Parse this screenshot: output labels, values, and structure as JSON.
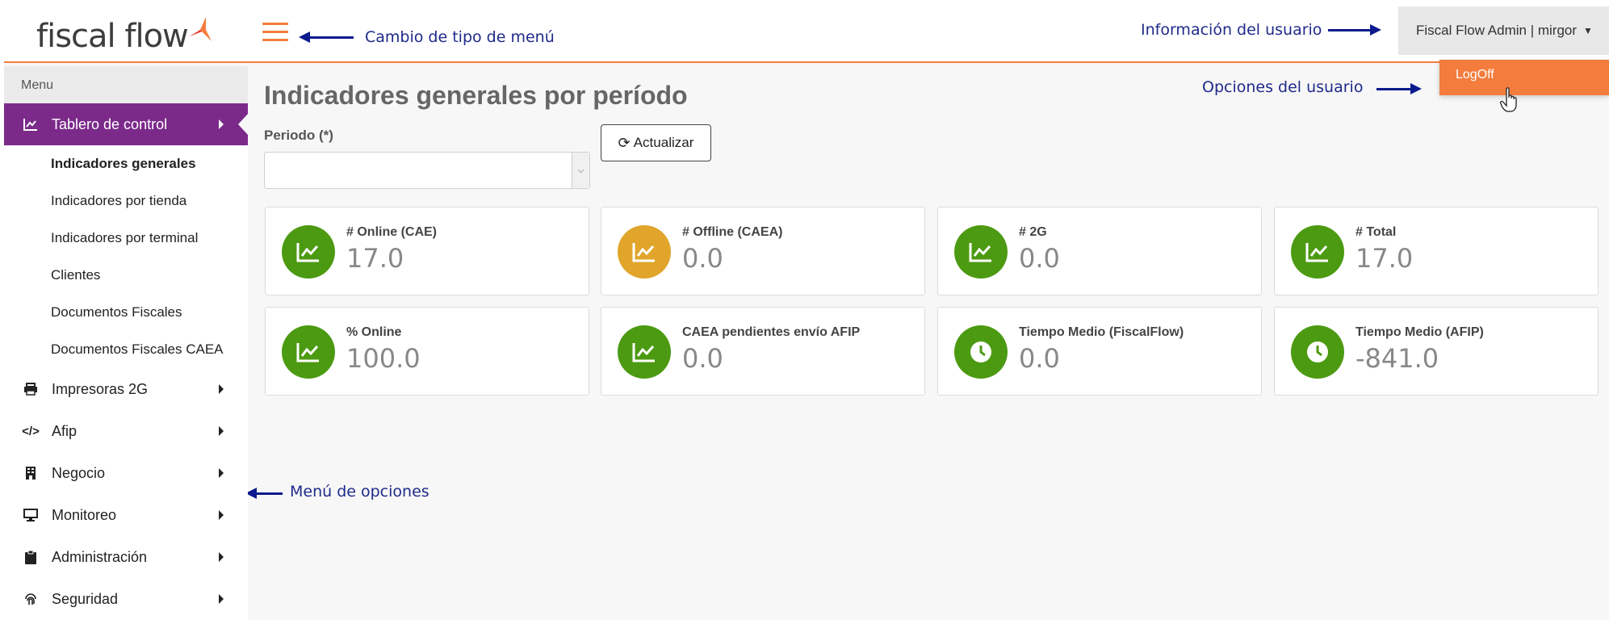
{
  "colors": {
    "accent": "#f47c3c",
    "active_nav": "#7b2a8a",
    "green": "#4c9a12",
    "yellow": "#e0a52a",
    "annotation": "#1f2a8a"
  },
  "brand": {
    "logo_text": "fiscal flow"
  },
  "header": {
    "user_label": "Fiscal Flow Admin | mirgor",
    "caret_icon": "caret-down-icon"
  },
  "user_menu": {
    "logoff_label": "LogOff"
  },
  "annotations": {
    "menu_type": "Cambio de tipo de menú",
    "user_info": "Información del usuario",
    "user_options": "Opciones del usuario",
    "menu_options": "Menú de opciones"
  },
  "sidebar": {
    "heading": "Menu",
    "active_item": {
      "label": "Tablero de control",
      "icon": "chart-line-icon"
    },
    "subitems": [
      "Indicadores generales",
      "Indicadores por tienda",
      "Indicadores por terminal",
      "Clientes",
      "Documentos Fiscales",
      "Documentos Fiscales CAEA"
    ],
    "items": [
      {
        "label": "Impresoras 2G",
        "icon": "printer-icon"
      },
      {
        "label": "Afip",
        "icon": "code-icon"
      },
      {
        "label": "Negocio",
        "icon": "building-icon"
      },
      {
        "label": "Monitoreo",
        "icon": "monitor-icon"
      },
      {
        "label": "Administración",
        "icon": "clipboard-icon"
      },
      {
        "label": "Seguridad",
        "icon": "fingerprint-icon"
      }
    ]
  },
  "main": {
    "title": "Indicadores generales por período",
    "period_label": "Periodo (*)",
    "period_value": "",
    "refresh_label": "Actualizar",
    "cards": [
      {
        "label": "# Online (CAE)",
        "value": "17.0",
        "icon": "chart-line-icon",
        "color": "green"
      },
      {
        "label": "# Offline (CAEA)",
        "value": "0.0",
        "icon": "chart-line-icon",
        "color": "yellow"
      },
      {
        "label": "# 2G",
        "value": "0.0",
        "icon": "chart-line-icon",
        "color": "green"
      },
      {
        "label": "# Total",
        "value": "17.0",
        "icon": "chart-line-icon",
        "color": "green"
      },
      {
        "label": "% Online",
        "value": "100.0",
        "icon": "chart-line-icon",
        "color": "green"
      },
      {
        "label": "CAEA pendientes envío AFIP",
        "value": "0.0",
        "icon": "chart-line-icon",
        "color": "green"
      },
      {
        "label": "Tiempo Medio (FiscalFlow)",
        "value": "0.0",
        "icon": "clock-icon",
        "color": "green"
      },
      {
        "label": "Tiempo Medio (AFIP)",
        "value": "-841.0",
        "icon": "clock-icon",
        "color": "green"
      }
    ]
  }
}
